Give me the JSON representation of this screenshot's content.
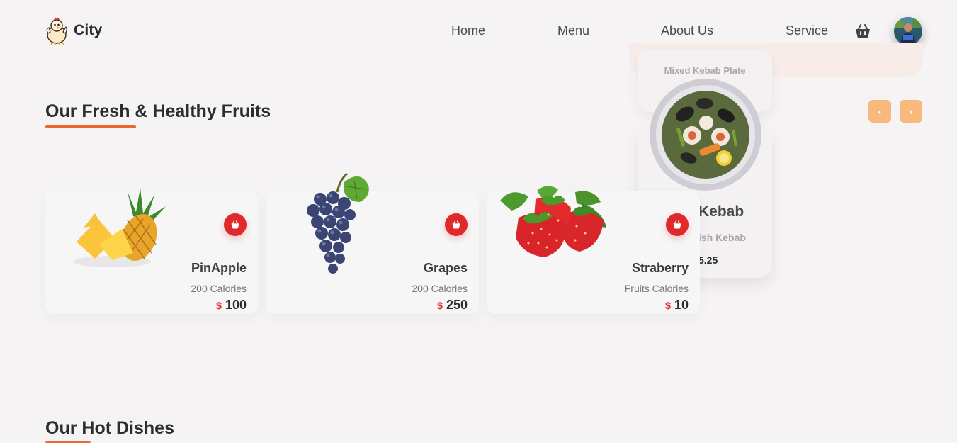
{
  "header": {
    "brand": "City",
    "nav": [
      "Home",
      "Menu",
      "About Us",
      "Service"
    ]
  },
  "dropdown": {
    "top_card_title": "Mixed Kebab Plate",
    "card_name_partial": "Kebab",
    "card_sub_partial": "ish Kebab",
    "card_price_partial": "5.25"
  },
  "sections": {
    "fruits_title": "Our Fresh & Healthy Fruits",
    "hot_title": "Our Hot Dishes"
  },
  "arrows": {
    "prev": "‹",
    "next": "›"
  },
  "fruits": [
    {
      "name": "PinApple",
      "calories": "200 Calories",
      "currency": "$",
      "price": "100"
    },
    {
      "name": "Grapes",
      "calories": "200 Calories",
      "currency": "$",
      "price": "250"
    },
    {
      "name": "Straberry",
      "calories": "Fruits Calories",
      "currency": "$",
      "price": "10"
    }
  ],
  "colors": {
    "accent_orange": "#e86b2e",
    "arrow_orange": "#f9b97d",
    "add_red": "#e0292a",
    "background": "#f5f3f3"
  }
}
